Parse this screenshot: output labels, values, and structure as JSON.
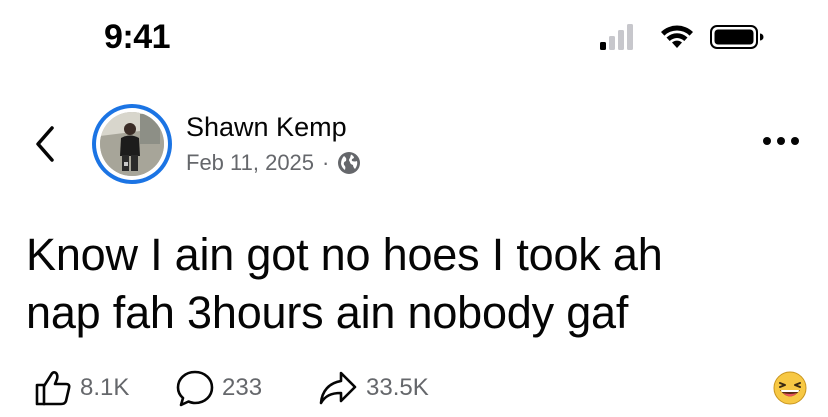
{
  "status_bar": {
    "time": "9:41",
    "icons": [
      "cellular-signal-icon",
      "wifi-icon",
      "battery-icon"
    ]
  },
  "post": {
    "author": {
      "name": "Shawn Kemp",
      "avatar_ring_color": "#1b74e4"
    },
    "date": "Feb 11, 2025",
    "separator": "·",
    "audience_icon": "globe-icon",
    "text_line1": "Know I ain got no hoes I took ah",
    "text_line2": "nap fah 3hours ain nobody gaf",
    "actions": {
      "likes": "8.1K",
      "comments": "233",
      "shares": "33.5K"
    },
    "reaction_icon": "laughing-emoji-icon"
  },
  "colors": {
    "text_primary": "#050505",
    "text_secondary": "#65676b",
    "accent": "#1b74e4"
  }
}
